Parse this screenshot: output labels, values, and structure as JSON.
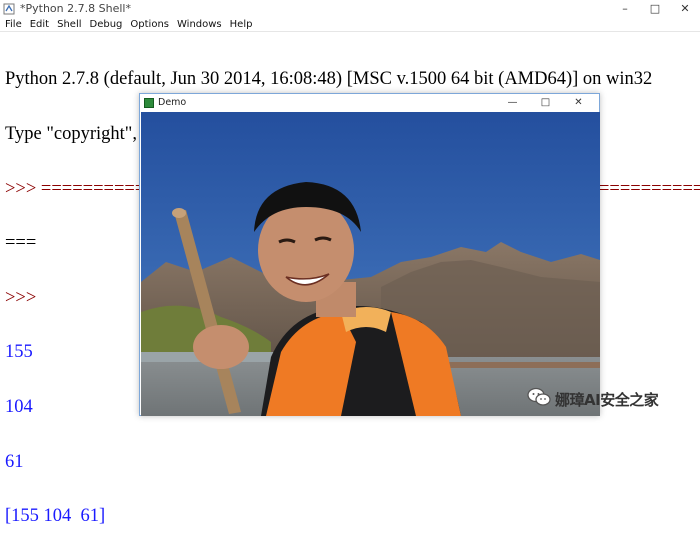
{
  "window": {
    "title": "*Python 2.7.8 Shell*",
    "controls": {
      "minimize": "–",
      "maximize": "□",
      "close": "✕"
    }
  },
  "menubar": [
    "File",
    "Edit",
    "Shell",
    "Debug",
    "Options",
    "Windows",
    "Help"
  ],
  "shell": {
    "banner_line1": "Python 2.7.8 (default, Jun 30 2014, 16:08:48) [MSC v.1500 64 bit (AMD64)] on win32",
    "banner_line2": "Type \"copyright\", \"credits\" or \"license()\" for more information.",
    "restart_line": ">>> ================================ RESTART ================================",
    "restart_wrap": "===",
    "prompt": ">>>",
    "outputs": [
      "155",
      "104",
      "61",
      "[155 104  61]"
    ]
  },
  "demo_window": {
    "title": "Demo",
    "controls": {
      "minimize": "—",
      "maximize": "□",
      "close": "✕"
    },
    "image_description_icon": "photo-boy-in-orange-life-vest-with-oar"
  },
  "watermark": {
    "text": "娜璋AI安全之家",
    "icon": "wechat-icon"
  },
  "colors": {
    "prompt": "#8b0000",
    "output": "#1a1aff",
    "sky": "#2e5aa6",
    "vest": "#f07a22"
  }
}
